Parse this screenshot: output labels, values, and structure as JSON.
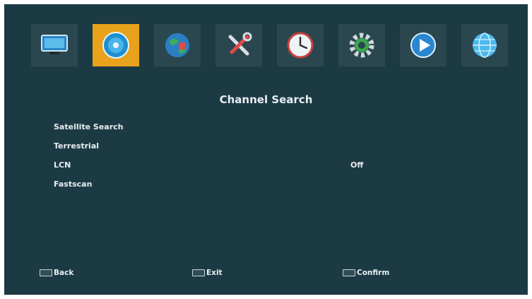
{
  "menu": {
    "title": "Channel Search",
    "items": [
      {
        "label": "Satellite Search",
        "value": ""
      },
      {
        "label": "Terrestrial",
        "value": ""
      },
      {
        "label": "LCN",
        "value": "Off"
      },
      {
        "label": "Fastscan",
        "value": ""
      }
    ]
  },
  "footer": {
    "back": "Back",
    "exit": "Exit",
    "confirm": "Confirm"
  },
  "colors": {
    "background": "#1c3a44",
    "tile": "#2a4750",
    "selected_tile": "#e9a21c",
    "text": "#e8eef0"
  }
}
